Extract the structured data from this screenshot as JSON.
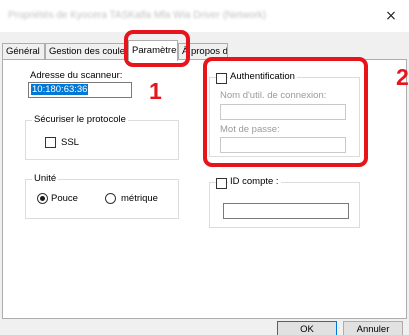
{
  "window": {
    "title": "Propriétés de Kyocera TASKalfa Mfa Wia Driver (Network)",
    "close_glyph": "×"
  },
  "tabs": [
    {
      "label": "Général"
    },
    {
      "label": "Gestion des couleu"
    },
    {
      "label": "Paramètres",
      "active": true
    },
    {
      "label": "À propos de"
    }
  ],
  "scanner": {
    "address_label": "Adresse du scanneur:",
    "address_value": "10:180:63:36"
  },
  "protocol": {
    "group_title": "Sécuriser le protocole",
    "ssl_label": "SSL",
    "ssl_checked": false
  },
  "unit": {
    "group_title": "Unité",
    "options": [
      {
        "label": "Pouce",
        "selected": true
      },
      {
        "label": "métrique",
        "selected": false
      }
    ]
  },
  "auth": {
    "checkbox_label": "Authentification",
    "checked": false,
    "username_label": "Nom d'util. de connexion:",
    "username_value": "",
    "password_label": "Mot de passe:",
    "password_value": ""
  },
  "account": {
    "checkbox_label": "ID compte :",
    "checked": false,
    "value": ""
  },
  "callouts": [
    {
      "number": "1"
    },
    {
      "number": "2"
    }
  ],
  "buttons": {
    "ok": "OK",
    "cancel": "Annuler"
  },
  "colors": {
    "callout": "#e8141c",
    "selection": "#0078d7"
  }
}
